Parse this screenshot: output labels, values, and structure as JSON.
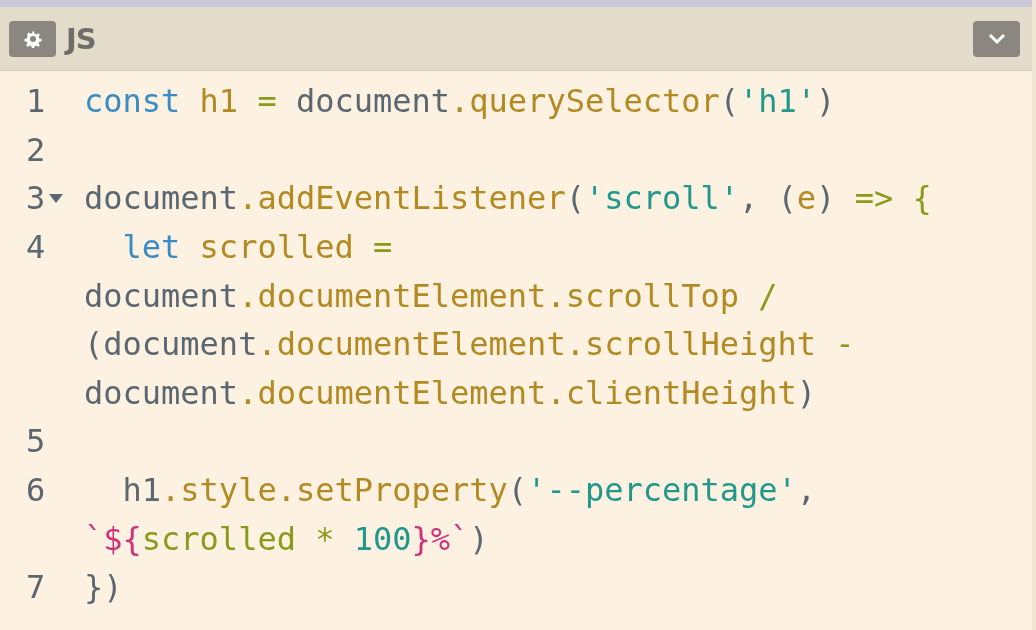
{
  "editor": {
    "title": "JS"
  },
  "rows": [
    {
      "number": "1",
      "foldable": false,
      "tokens": [
        {
          "text": "const",
          "kind": "keyword"
        },
        {
          "text": " h1",
          "kind": "variable"
        },
        {
          "text": " =",
          "kind": "operator"
        },
        {
          "text": " document",
          "kind": "plain"
        },
        {
          "text": ".querySelector",
          "kind": "property"
        },
        {
          "text": "(",
          "kind": "plain"
        },
        {
          "text": "'h1'",
          "kind": "string"
        },
        {
          "text": ")",
          "kind": "plain"
        }
      ]
    },
    {
      "number": "2",
      "foldable": false,
      "tokens": []
    },
    {
      "number": "3",
      "foldable": true,
      "tokens": [
        {
          "text": "document",
          "kind": "plain"
        },
        {
          "text": ".addEventListener",
          "kind": "property"
        },
        {
          "text": "(",
          "kind": "plain"
        },
        {
          "text": "'scroll'",
          "kind": "string"
        },
        {
          "text": ", (",
          "kind": "plain"
        },
        {
          "text": "e",
          "kind": "variable"
        },
        {
          "text": ")",
          "kind": "plain"
        },
        {
          "text": " => {",
          "kind": "operator"
        }
      ]
    },
    {
      "number": "4",
      "foldable": false,
      "tokens": [
        {
          "text": "  let",
          "kind": "keyword"
        },
        {
          "text": " scrolled",
          "kind": "variable"
        },
        {
          "text": " =",
          "kind": "operator"
        }
      ]
    },
    {
      "foldable": false,
      "tokens": [
        {
          "text": "document",
          "kind": "plain"
        },
        {
          "text": ".documentElement.scrollTop",
          "kind": "property"
        },
        {
          "text": " /",
          "kind": "operator"
        }
      ]
    },
    {
      "foldable": false,
      "tokens": [
        {
          "text": "(document",
          "kind": "plain"
        },
        {
          "text": ".documentElement.scrollHeight",
          "kind": "property"
        },
        {
          "text": " -",
          "kind": "operator"
        }
      ]
    },
    {
      "foldable": false,
      "tokens": [
        {
          "text": "document",
          "kind": "plain"
        },
        {
          "text": ".documentElement.clientHeight",
          "kind": "property"
        },
        {
          "text": ")",
          "kind": "plain"
        }
      ]
    },
    {
      "number": "5",
      "foldable": false,
      "tokens": []
    },
    {
      "number": "6",
      "foldable": false,
      "tokens": [
        {
          "text": "  h1",
          "kind": "plain"
        },
        {
          "text": ".style.setProperty",
          "kind": "property"
        },
        {
          "text": "(",
          "kind": "plain"
        },
        {
          "text": "'--percentage'",
          "kind": "string"
        },
        {
          "text": ",",
          "kind": "plain"
        }
      ]
    },
    {
      "foldable": false,
      "tokens": [
        {
          "text": "`${",
          "kind": "template"
        },
        {
          "text": "scrolled * ",
          "kind": "operator"
        },
        {
          "text": "100",
          "kind": "number"
        },
        {
          "text": "}%`",
          "kind": "template"
        },
        {
          "text": ")",
          "kind": "plain"
        }
      ]
    },
    {
      "number": "7",
      "foldable": false,
      "tokens": [
        {
          "text": "})",
          "kind": "plain"
        }
      ]
    }
  ]
}
